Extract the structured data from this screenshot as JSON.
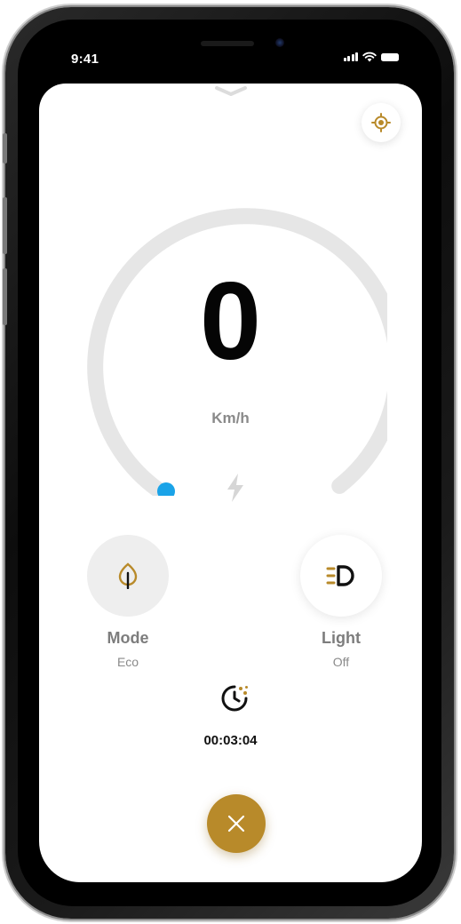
{
  "status_bar": {
    "time": "9:41",
    "icons": [
      "cellular-signal-icon",
      "wifi-icon",
      "battery-icon"
    ]
  },
  "header": {
    "collapse_icon": "chevron-down-icon",
    "locate_icon": "crosshair-target-icon"
  },
  "speedometer": {
    "speed": "0",
    "unit": "Km/h",
    "progress": 0,
    "charging_icon": "lightning-bolt-icon"
  },
  "mode": {
    "label": "Mode",
    "value": "Eco",
    "icon": "leaf-icon"
  },
  "light": {
    "label": "Light",
    "value": "Off",
    "icon": "headlight-icon"
  },
  "ride_timer": {
    "icon": "stopwatch-icon",
    "elapsed": "00:03:04"
  },
  "actions": {
    "end_ride_icon": "close-icon"
  },
  "colors": {
    "accent": "#b88a2a",
    "indicator": "#1aa3e8",
    "track": "#e6e6e6"
  }
}
